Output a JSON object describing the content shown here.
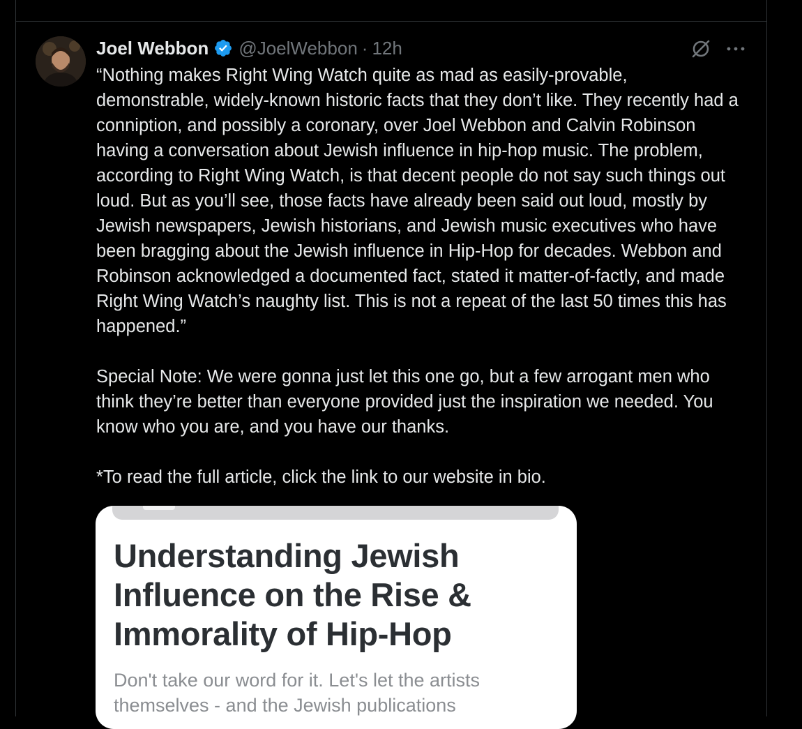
{
  "tweet": {
    "author_name": "Joel Webbon",
    "handle": "@JoelWebbon",
    "separator": "·",
    "time": "12h",
    "paragraphs": [
      "“Nothing makes Right Wing Watch quite as mad as easily-provable, demonstrable, widely-known historic facts that they don’t like. They recently had a conniption, and possibly a coronary, over Joel Webbon and Calvin Robinson having a conversation about Jewish influence in hip-hop music. The problem, according to Right Wing Watch, is that decent people do not say such things out loud. But as you’ll see, those facts have already been said out loud, mostly by Jewish newspapers, Jewish historians, and Jewish music executives who have been bragging about the Jewish influence in Hip-Hop for decades. Webbon and Robinson acknowledged a documented fact, stated it matter-of-factly, and made Right Wing Watch’s naughty list. This is not a repeat of the last 50 times this has happened.”",
      "Special Note: We were gonna just let this one go, but a few arrogant men who think they’re better than everyone provided just the inspiration we needed. You know who you are, and you have our thanks.",
      "*To read the full article, click the link to our website in bio."
    ],
    "icons": {
      "verified": "verified-badge-icon",
      "grok": "grok-icon",
      "more": "more-dots-icon"
    }
  },
  "attached_image": {
    "headline": "Understanding Jewish Influence on the Rise & Immorality of Hip-Hop",
    "description": "Don't take our word for it. Let's let the artists themselves - and the Jewish publications"
  },
  "colors": {
    "background": "#000000",
    "text_primary": "#e7e9ea",
    "text_secondary": "#71767b",
    "verified_blue": "#1d9bf0",
    "border": "#2f3336"
  }
}
